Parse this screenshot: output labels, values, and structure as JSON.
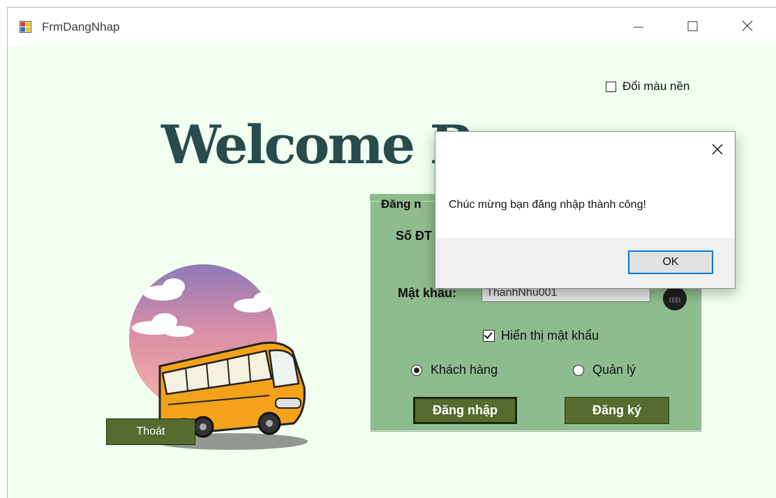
{
  "window": {
    "title": "FrmDangNhap"
  },
  "options": {
    "change_background_label": "Đổi màu nền"
  },
  "welcome_text": "Welcome B",
  "login_group": {
    "title": "Đăng n",
    "phone_label": "Số ĐT",
    "password_label": "Mật khẩu:",
    "password_value": "ThanhNhu001",
    "show_password_label": "Hiển thị mật khẩu",
    "show_password_checked": true,
    "role_customer_label": "Khách hàng",
    "role_manager_label": "Quản lý",
    "selected_role": "Khách hàng",
    "login_button": "Đăng nhập",
    "register_button": "Đăng ký"
  },
  "exit_button": "Thoát",
  "message_box": {
    "message": "Chúc mừng bạn đăng nhập thành công!",
    "ok_label": "OK"
  },
  "colors": {
    "background": "#f0fff0",
    "group_background": "#8fbc8f",
    "button_green": "#556b2f",
    "welcome_text": "#2a4b4c",
    "accent": "#0078d7"
  },
  "icons": [
    "app-icon",
    "minimize-icon",
    "maximize-icon",
    "close-icon",
    "eye-icon",
    "dialog-close-icon"
  ]
}
